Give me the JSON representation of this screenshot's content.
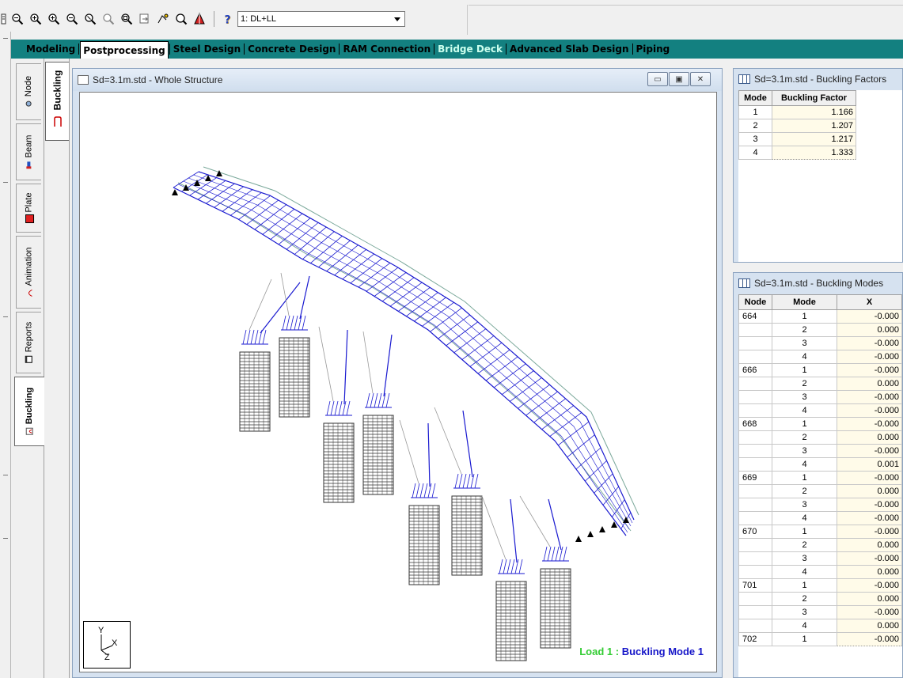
{
  "toolbar": {
    "buttons": [
      "zoom-fit-icon",
      "zoom-in-icon",
      "zoom-in-window-icon",
      "zoom-out-icon",
      "zoom-dynamic-icon",
      "zoom-previous-icon",
      "zoom-window-icon",
      "pan-icon",
      "zoom-region-icon",
      "magnify-icon",
      "3d-render-icon"
    ],
    "help_icon": "help-icon",
    "load_case": "1: DL+LL"
  },
  "page_tabs": [
    {
      "label": "Modeling",
      "active": false,
      "light": false
    },
    {
      "label": "Postprocessing",
      "active": true,
      "light": false
    },
    {
      "label": "Steel Design",
      "active": false,
      "light": false
    },
    {
      "label": "Concrete Design",
      "active": false,
      "light": false
    },
    {
      "label": "RAM Connection",
      "active": false,
      "light": false
    },
    {
      "label": "Bridge Deck",
      "active": false,
      "light": true
    },
    {
      "label": "Advanced Slab Design",
      "active": false,
      "light": false
    },
    {
      "label": "Piping",
      "active": false,
      "light": false
    }
  ],
  "side_tabs": [
    {
      "label": "Node",
      "icon": "node-icon"
    },
    {
      "label": "Beam",
      "icon": "beam-icon"
    },
    {
      "label": "Plate",
      "icon": "plate-icon"
    },
    {
      "label": "Animation",
      "icon": "animation-icon"
    },
    {
      "label": "Reports",
      "icon": "reports-icon"
    },
    {
      "label": "Buckling",
      "icon": "buckling-icon"
    }
  ],
  "sub_tab": {
    "label": "Buckling",
    "icon": "buckling-mode-icon"
  },
  "main_window": {
    "title": "Sd=3.1m.std - Whole Structure",
    "axis": {
      "y": "Y",
      "x": "X",
      "z": "Z"
    },
    "caption_load": "Load 1 :",
    "caption_mode": "Buckling Mode 1"
  },
  "factors_panel": {
    "title": "Sd=3.1m.std - Buckling Factors",
    "headers": [
      "Mode",
      "Buckling Factor"
    ],
    "rows": [
      {
        "mode": "1",
        "factor": "1.166"
      },
      {
        "mode": "2",
        "factor": "1.207"
      },
      {
        "mode": "3",
        "factor": "1.217"
      },
      {
        "mode": "4",
        "factor": "1.333"
      }
    ]
  },
  "modes_panel": {
    "title": "Sd=3.1m.std - Buckling Modes",
    "headers": [
      "Node",
      "Mode",
      "X"
    ],
    "rows": [
      {
        "node": "664",
        "mode": "1",
        "x": "-0.000"
      },
      {
        "node": "",
        "mode": "2",
        "x": "0.000"
      },
      {
        "node": "",
        "mode": "3",
        "x": "-0.000"
      },
      {
        "node": "",
        "mode": "4",
        "x": "-0.000"
      },
      {
        "node": "666",
        "mode": "1",
        "x": "-0.000"
      },
      {
        "node": "",
        "mode": "2",
        "x": "0.000"
      },
      {
        "node": "",
        "mode": "3",
        "x": "-0.000"
      },
      {
        "node": "",
        "mode": "4",
        "x": "-0.000"
      },
      {
        "node": "668",
        "mode": "1",
        "x": "-0.000"
      },
      {
        "node": "",
        "mode": "2",
        "x": "0.000"
      },
      {
        "node": "",
        "mode": "3",
        "x": "-0.000"
      },
      {
        "node": "",
        "mode": "4",
        "x": "0.001"
      },
      {
        "node": "669",
        "mode": "1",
        "x": "-0.000"
      },
      {
        "node": "",
        "mode": "2",
        "x": "0.000"
      },
      {
        "node": "",
        "mode": "3",
        "x": "-0.000"
      },
      {
        "node": "",
        "mode": "4",
        "x": "-0.000"
      },
      {
        "node": "670",
        "mode": "1",
        "x": "-0.000"
      },
      {
        "node": "",
        "mode": "2",
        "x": "0.000"
      },
      {
        "node": "",
        "mode": "3",
        "x": "-0.000"
      },
      {
        "node": "",
        "mode": "4",
        "x": "0.000"
      },
      {
        "node": "701",
        "mode": "1",
        "x": "-0.000"
      },
      {
        "node": "",
        "mode": "2",
        "x": "0.000"
      },
      {
        "node": "",
        "mode": "3",
        "x": "-0.000"
      },
      {
        "node": "",
        "mode": "4",
        "x": "0.000"
      },
      {
        "node": "702",
        "mode": "1",
        "x": "-0.000"
      }
    ]
  },
  "colors": {
    "deck": "#1a1ad0",
    "deck_original": "#7aa89a",
    "pile": "#333333",
    "tab_bar": "#138080"
  }
}
